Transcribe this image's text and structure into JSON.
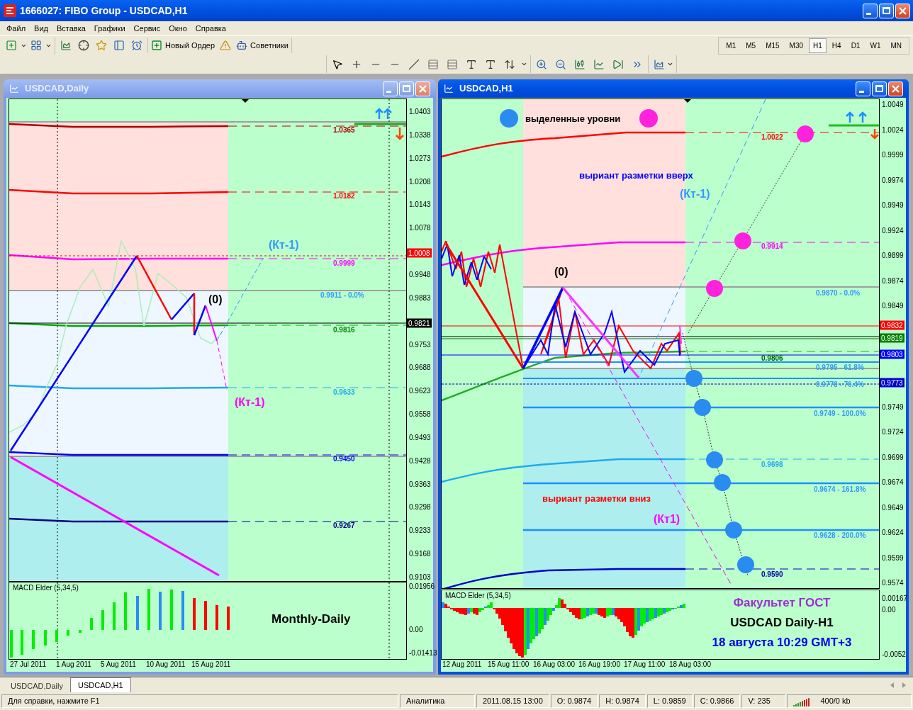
{
  "window": {
    "title": "1666027: FIBO Group - USDCAD,H1"
  },
  "menu": [
    "Файл",
    "Вид",
    "Вставка",
    "Графики",
    "Сервис",
    "Окно",
    "Справка"
  ],
  "toolbar": {
    "order_button": "Новый Ордер",
    "experts_button": "Советники",
    "timeframes": [
      {
        "label": "M1",
        "selected": false
      },
      {
        "label": "M5",
        "selected": false
      },
      {
        "label": "M15",
        "selected": false
      },
      {
        "label": "M30",
        "selected": false
      },
      {
        "label": "H1",
        "selected": true
      },
      {
        "label": "H4",
        "selected": false
      },
      {
        "label": "D1",
        "selected": false
      },
      {
        "label": "W1",
        "selected": false
      },
      {
        "label": "MN",
        "selected": false
      }
    ]
  },
  "charts": [
    {
      "title": "USDCAD,Daily",
      "active": false,
      "price_ticks": [
        "1.0403",
        "1.0338",
        "1.0273",
        "1.0208",
        "1.0143",
        "1.0078",
        "0.9948",
        "0.9883",
        "0.9753",
        "0.9688",
        "0.9623",
        "0.9558",
        "0.9493",
        "0.9428",
        "0.9363",
        "0.9298",
        "0.9233",
        "0.9168",
        "0.9103"
      ],
      "price_tags": [
        {
          "text": "1.0008",
          "color": "#ff0000"
        },
        {
          "text": "0.9821",
          "color": "#000000"
        }
      ],
      "levels": [
        {
          "text": "1.0365",
          "color": "#b00000"
        },
        {
          "text": "1.0182",
          "color": "#ff0000"
        },
        {
          "text": "0.9999",
          "color": "#ff00ff"
        },
        {
          "text": "0.9911 - 0.0%",
          "color": "#3399ff"
        },
        {
          "text": "0.9816",
          "color": "#008800"
        },
        {
          "text": "0.9633",
          "color": "#1eaaf0"
        },
        {
          "text": "0.9450",
          "color": "#0000ee"
        },
        {
          "text": "0.9267",
          "color": "#000080"
        }
      ],
      "annotations": [
        {
          "text": "(Кт-1)",
          "color": "#3399ff"
        },
        {
          "text": "(0)",
          "color": "#000000"
        },
        {
          "text": "(Кт-1)",
          "color": "#ff00ff"
        }
      ],
      "indicator": {
        "name": "MACD Elder (5,34,5)",
        "ticks": [
          "0.01956",
          "0.00",
          "-0.01413"
        ],
        "captions": [
          {
            "text": "Monthly-Daily",
            "color": "#000000"
          }
        ]
      },
      "time_labels": [
        "27 Jul 2011",
        "1 Aug 2011",
        "5 Aug 2011",
        "10 Aug 2011",
        "15 Aug 2011"
      ]
    },
    {
      "title": "USDCAD,H1",
      "active": true,
      "price_ticks": [
        "1.0049",
        "1.0024",
        "0.9999",
        "0.9974",
        "0.9949",
        "0.9924",
        "0.9899",
        "0.9874",
        "0.9849",
        "0.9749",
        "0.9724",
        "0.9699",
        "0.9674",
        "0.9649",
        "0.9624",
        "0.9599",
        "0.9574"
      ],
      "price_tags": [
        {
          "text": "0.9832",
          "color": "#ff0000"
        },
        {
          "text": "0.9819",
          "color": "#008000"
        },
        {
          "text": "0.9803",
          "color": "#0000ff"
        },
        {
          "text": "0.9773",
          "color": "#0000cc"
        }
      ],
      "levels": [
        {
          "text": "1.0022",
          "color": "#ff0000"
        },
        {
          "text": "0.9914",
          "color": "#ff00ff"
        },
        {
          "text": "0.9870 - 0.0%",
          "color": "#3399ff"
        },
        {
          "text": "0.9806",
          "color": "#006600"
        },
        {
          "text": "0.9795 - 61.8%",
          "color": "#3399ff"
        },
        {
          "text": "0.9778 - 76.4%",
          "color": "#3399ff"
        },
        {
          "text": "0.9749 - 100.0%",
          "color": "#3399ff"
        },
        {
          "text": "0.9698",
          "color": "#1eaaf0"
        },
        {
          "text": "0.9674 - 161.8%",
          "color": "#3399ff"
        },
        {
          "text": "0.9628 - 200.0%",
          "color": "#3399ff"
        },
        {
          "text": "0.9590",
          "color": "#0000aa"
        }
      ],
      "annotations": [
        {
          "text": "выделенные уровни",
          "color": "#000000"
        },
        {
          "text": "выриант разметки вверх",
          "color": "#0000ff"
        },
        {
          "text": "(Кт-1)",
          "color": "#3399ff"
        },
        {
          "text": "(0)",
          "color": "#000000"
        },
        {
          "text": "выриант разметки вниз",
          "color": "#ff0000"
        },
        {
          "text": "(Кт1)",
          "color": "#ff00ff"
        }
      ],
      "indicator": {
        "name": "MACD Elder (5,34,5)",
        "ticks": [
          "0.00167",
          "0.00",
          "-0.0052"
        ],
        "captions": [
          {
            "text": "Факультет ГОСТ",
            "color": "#9b30d0"
          },
          {
            "text": "USDCAD Daily-H1",
            "color": "#000000"
          },
          {
            "text": "18 августа 10:29 GMT+3",
            "color": "#0000ee"
          }
        ]
      },
      "time_labels": [
        "12 Aug 2011",
        "15 Aug 11:00",
        "16 Aug 03:00",
        "16 Aug 19:00",
        "17 Aug 11:00",
        "18 Aug 03:00"
      ]
    }
  ],
  "tabs": [
    {
      "label": "USDCAD,Daily",
      "selected": false
    },
    {
      "label": "USDCAD,H1",
      "selected": true
    }
  ],
  "status_bar": {
    "help": "Для справки, нажмите F1",
    "profile": "Аналитика",
    "time": "2011.08.15 13:00",
    "open": "O: 0.9874",
    "high": "H: 0.9874",
    "low": "L: 0.9859",
    "close": "C: 0.9866",
    "volume": "V: 235",
    "traffic": "400/0 kb"
  }
}
